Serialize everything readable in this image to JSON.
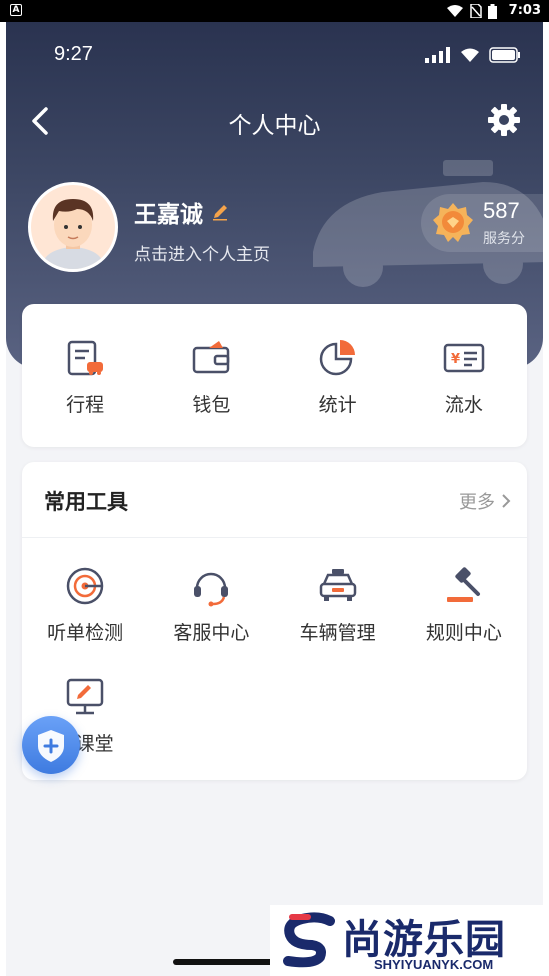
{
  "system_bar": {
    "app_badge": "A",
    "time": "7:03"
  },
  "ios_status": {
    "time": "9:27"
  },
  "header": {
    "title": "个人中心"
  },
  "profile": {
    "name": "王嘉诚",
    "subtitle": "点击进入个人主页"
  },
  "score": {
    "value": "587",
    "label": "服务分"
  },
  "quick_actions": [
    {
      "label": "行程",
      "icon": "trip-icon"
    },
    {
      "label": "钱包",
      "icon": "wallet-icon"
    },
    {
      "label": "统计",
      "icon": "pie-chart-icon"
    },
    {
      "label": "流水",
      "icon": "ledger-icon"
    }
  ],
  "tools": {
    "title": "常用工具",
    "more_label": "更多",
    "items": [
      {
        "label": "听单检测",
        "icon": "target-icon"
      },
      {
        "label": "客服中心",
        "icon": "headset-icon"
      },
      {
        "label": "车辆管理",
        "icon": "car-icon"
      },
      {
        "label": "规则中心",
        "icon": "gavel-icon"
      },
      {
        "label": "机课堂",
        "icon": "classroom-icon"
      }
    ]
  },
  "watermark": {
    "brand_cn": "尚游乐园",
    "brand_url": "SHYIYUANYK.COM"
  },
  "colors": {
    "accent": "#f26b3a",
    "icon_gray": "#4a5068",
    "header_dark": "#2a3350"
  }
}
